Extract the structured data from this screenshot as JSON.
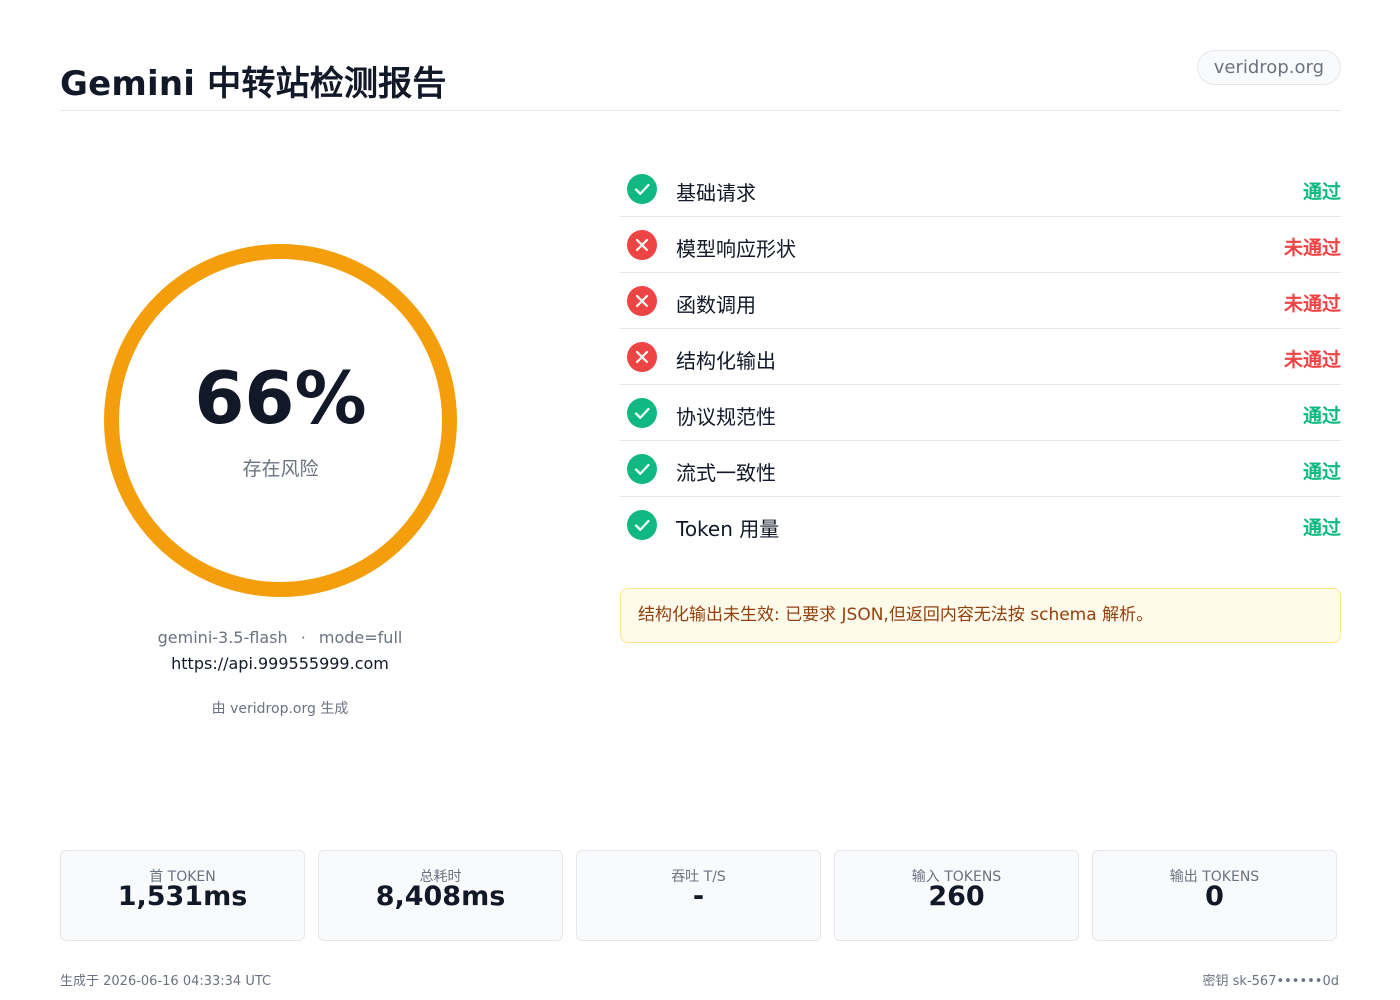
{
  "header": {
    "title": "Gemini 中转站检测报告",
    "domain": "veridrop.org"
  },
  "score": {
    "value": "66%",
    "fraction": 0.66,
    "label": "存在风险",
    "ring_color": "#f59e0b"
  },
  "meta": {
    "model": "gemini-3.5-flash",
    "separator": "·",
    "mode": "mode=full",
    "url": "https://api.999555999.com",
    "generated_by": "由 veridrop.org 生成"
  },
  "checks": [
    {
      "name": "基础请求",
      "status": "通过",
      "result": "pass",
      "icon": "check-icon"
    },
    {
      "name": "模型响应形状",
      "status": "未通过",
      "result": "fail",
      "icon": "x-icon"
    },
    {
      "name": "函数调用",
      "status": "未通过",
      "result": "fail",
      "icon": "x-icon"
    },
    {
      "name": "结构化输出",
      "status": "未通过",
      "result": "fail",
      "icon": "x-icon"
    },
    {
      "name": "协议规范性",
      "status": "通过",
      "result": "pass",
      "icon": "check-icon"
    },
    {
      "name": "流式一致性",
      "status": "通过",
      "result": "pass",
      "icon": "check-icon"
    },
    {
      "name": "Token 用量",
      "status": "通过",
      "result": "pass",
      "icon": "check-icon"
    }
  ],
  "notice": {
    "text": "结构化输出未生效: 已要求 JSON,但返回内容无法按 schema 解析。"
  },
  "stats": [
    {
      "label": "首 TOKEN",
      "value": "1,531ms"
    },
    {
      "label": "总耗时",
      "value": "8,408ms"
    },
    {
      "label": "吞吐 T/S",
      "value": "-"
    },
    {
      "label": "输入 TOKENS",
      "value": "260"
    },
    {
      "label": "输出 TOKENS",
      "value": "0"
    }
  ],
  "footer": {
    "generated_at": "生成于 2026-06-16 04:33:34 UTC",
    "key": "密钥 sk-567••••••0d"
  },
  "colors": {
    "pass": "#10b981",
    "fail": "#ef4444",
    "warning_bg": "#fffbeb",
    "warning_text": "#92400e"
  }
}
